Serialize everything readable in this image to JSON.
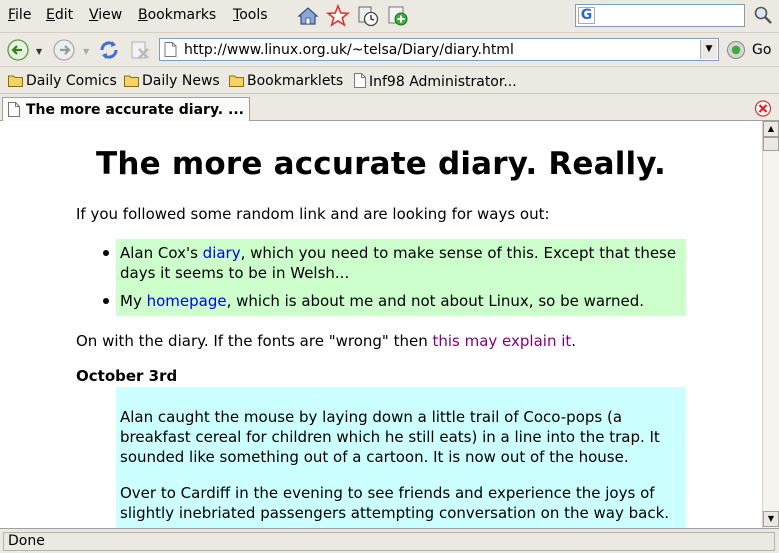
{
  "menu": {
    "items": [
      {
        "underline": "F",
        "rest": "ile"
      },
      {
        "underline": "E",
        "rest": "dit"
      },
      {
        "underline": "V",
        "rest": "iew"
      },
      {
        "underline": "B",
        "rest": "ookmarks"
      },
      {
        "underline": "T",
        "rest": "ools"
      }
    ]
  },
  "toolbar_icons": [
    "home-icon",
    "star-bookmark-icon",
    "history-clock-icon",
    "new-tab-plus-icon"
  ],
  "search": {
    "engine": "G",
    "value": "",
    "engine_icon": "google-icon"
  },
  "nav": {
    "back_icon": "back-arrow-icon",
    "forward_icon": "forward-arrow-icon",
    "reload_icon": "reload-icon",
    "stop_icon": "stop-icon",
    "url": "http://www.linux.org.uk/~telsa/Diary/diary.html",
    "go_label": "Go"
  },
  "bookmarks": [
    {
      "label": "Daily Comics",
      "icon": "folder-icon"
    },
    {
      "label": "Daily News",
      "icon": "folder-icon"
    },
    {
      "label": "Bookmarklets",
      "icon": "folder-icon"
    },
    {
      "label": "Inf98 Administrator...",
      "icon": "page-icon"
    }
  ],
  "tab": {
    "title": "The more accurate diary. ..."
  },
  "page": {
    "title": "The more accurate diary. Really.",
    "intro": "If you followed some random link and are looking for ways out:",
    "list": {
      "item1_before": "Alan Cox's ",
      "item1_link": "diary",
      "item1_after_line1": ", which you need to make sense of this. Except that these",
      "item1_line2": "days it seems to be in Welsh...",
      "item2_before": "My ",
      "item2_link": "homepage",
      "item2_after": ", which is about me and not about Linux, so be warned."
    },
    "fonts_before": "On with the diary. If the fonts are \"wrong\" then ",
    "fonts_link": "this may explain it",
    "fonts_after": ".",
    "date_heading": "October 3rd",
    "entry_p1_l1": "Alan caught the mouse by laying down a little trail of Coco-pops (a",
    "entry_p1_l2": "breakfast cereal for children which he still eats) in a line into the trap. It",
    "entry_p1_l3": "sounded like something out of a cartoon. It is now out of the house.",
    "entry_p2_l1": "Over to Cardiff in the evening to see friends and experience the joys of",
    "entry_p2_l2": "slightly inebriated passengers attempting conversation on the way back."
  },
  "colors": {
    "link": "#0000ee",
    "visited_link": "#800080",
    "list_background": "#ccffcc",
    "entry_background": "#ccffff"
  },
  "status": {
    "text": "Done"
  }
}
